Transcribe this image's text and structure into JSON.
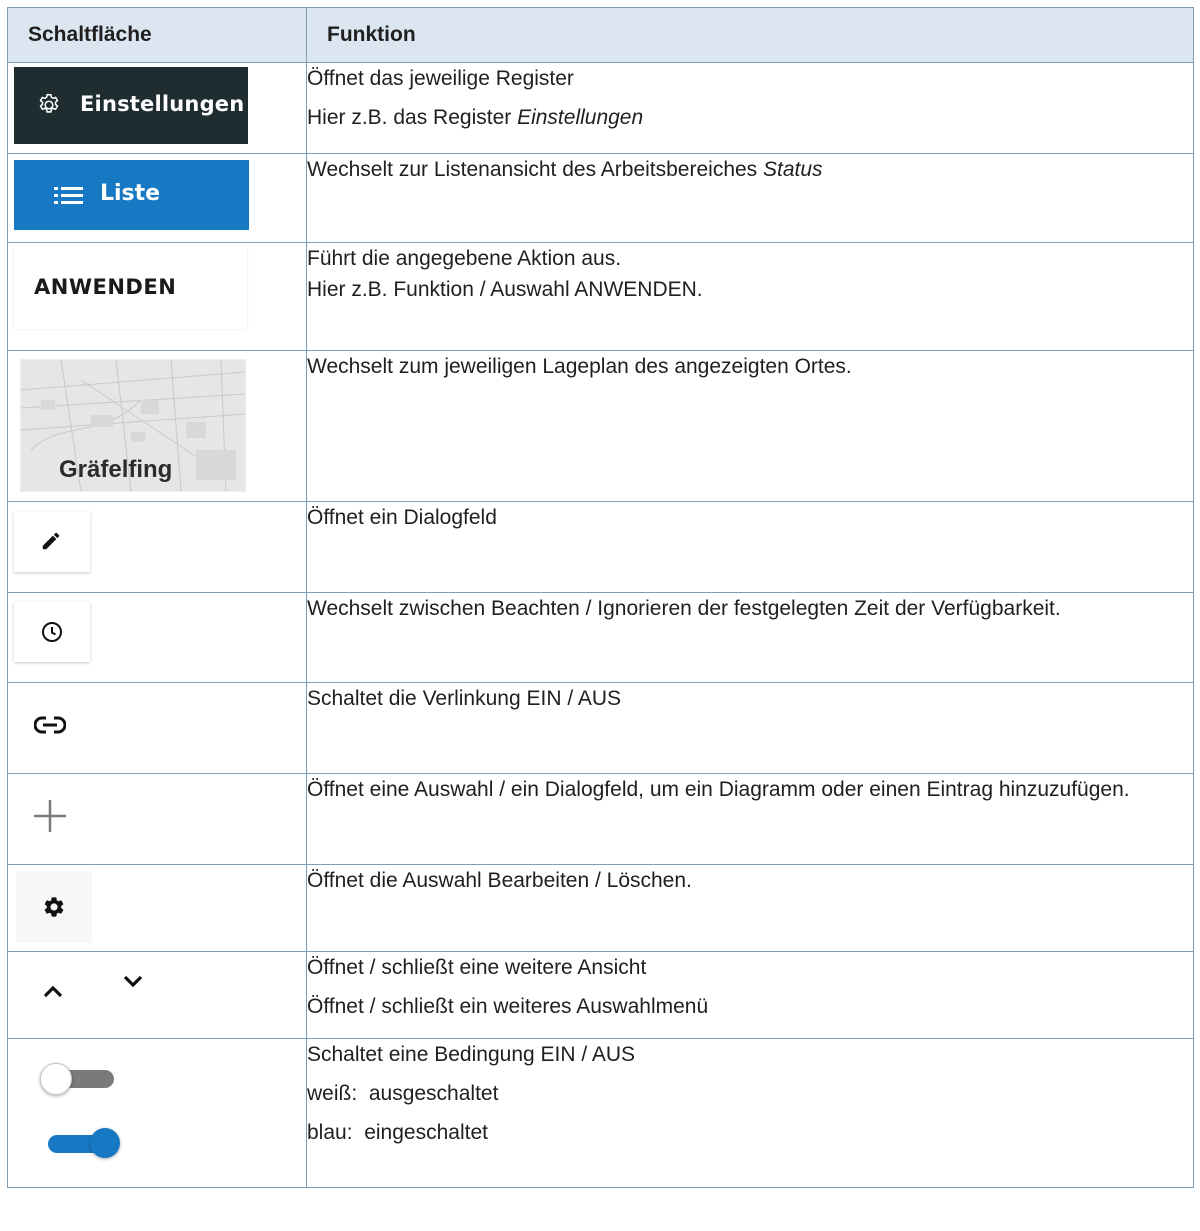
{
  "table": {
    "header_button": "Schaltfläche",
    "header_function": "Funktion"
  },
  "rows": [
    {
      "button": {
        "kind": "settings-button",
        "label": "Einstellungen",
        "icon": "gear-outline-icon",
        "bg": "#1f2d31"
      },
      "lines": [
        {
          "text": "Öffnet das jeweilige Register"
        },
        {
          "prefix": "Hier z.B. das Register ",
          "italic": "Einstellungen"
        }
      ]
    },
    {
      "button": {
        "kind": "list-button",
        "label": "Liste",
        "icon": "list-icon",
        "bg": "#1779c3"
      },
      "lines": [
        {
          "prefix": "Wechselt zur Listenansicht des Arbeitsbereiches ",
          "italic": "Status"
        }
      ]
    },
    {
      "button": {
        "kind": "text-button",
        "label": "ANWENDEN"
      },
      "lines": [
        {
          "text": "Führt die angegebene Aktion aus."
        },
        {
          "text": "Hier z.B. Funktion / Auswahl ANWENDEN."
        }
      ]
    },
    {
      "button": {
        "kind": "map-tile",
        "label": "Gräfelfing"
      },
      "lines": [
        {
          "text": "Wechselt zum jeweiligen Lageplan des angezeigten Ortes."
        }
      ]
    },
    {
      "button": {
        "kind": "icon-button",
        "icon": "pencil-icon"
      },
      "lines": [
        {
          "text": "Öffnet ein Dialogfeld"
        }
      ]
    },
    {
      "button": {
        "kind": "icon-button",
        "icon": "clock-icon"
      },
      "lines": [
        {
          "text": "Wechselt zwischen Beachten / Ignorieren der festgelegten Zeit der Verfügbarkeit."
        }
      ]
    },
    {
      "button": {
        "kind": "icon",
        "icon": "link-icon"
      },
      "lines": [
        {
          "text": "Schaltet die Verlinkung EIN / AUS"
        }
      ]
    },
    {
      "button": {
        "kind": "icon",
        "icon": "plus-icon"
      },
      "lines": [
        {
          "text": "Öffnet eine Auswahl / ein Dialogfeld, um ein Diagramm oder einen Eintrag hinzuzufügen."
        }
      ]
    },
    {
      "button": {
        "kind": "icon",
        "icon": "gear-icon"
      },
      "lines": [
        {
          "text": "Öffnet die Auswahl Bearbeiten / Löschen."
        }
      ]
    },
    {
      "button": {
        "kind": "chevrons",
        "icons": [
          "chevron-up-icon",
          "chevron-down-icon"
        ]
      },
      "lines": [
        {
          "text": "Öffnet / schließt eine weitere Ansicht"
        },
        {
          "text": "Öffnet / schließt ein weiteres Auswahlmenü"
        }
      ]
    },
    {
      "button": {
        "kind": "toggles",
        "off_color": "#ffffff",
        "on_color": "#1779c3"
      },
      "lines": [
        {
          "text": "Schaltet eine Bedingung EIN / AUS"
        },
        {
          "text": "weiß:  ausgeschaltet"
        },
        {
          "text": "blau:  eingeschaltet"
        }
      ]
    }
  ]
}
